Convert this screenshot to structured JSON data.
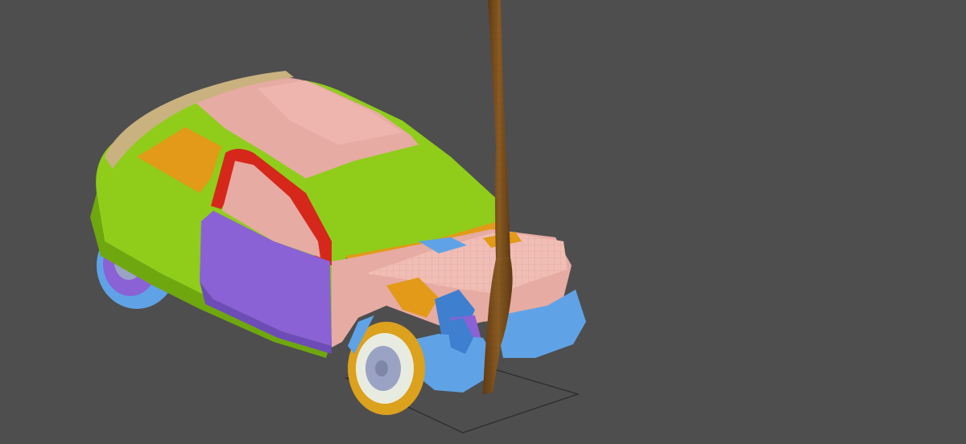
{
  "viewport": {
    "background": "#4e4e4e"
  },
  "model": {
    "colors": {
      "body_green": "#8fcd1a",
      "body_green_dark": "#6fa70f",
      "roof_pink": "#e6aba3",
      "roof_pink_light": "#f1bdb5",
      "door_purple": "#8a62d6",
      "door_purple_dark": "#6d4cb8",
      "window_orange": "#e29a18",
      "trim_red": "#d5281b",
      "bumper_blue": "#5fa3e6",
      "bumper_blue_dark": "#3f7fd0",
      "tire_orange": "#dca11d",
      "hub_gray": "#9aa3c4",
      "spoiler_tan": "#c9b27f",
      "pole_brown": "#8a5a22",
      "pole_dark": "#5f3b12",
      "ground_outline": "#2b2b2b"
    }
  }
}
